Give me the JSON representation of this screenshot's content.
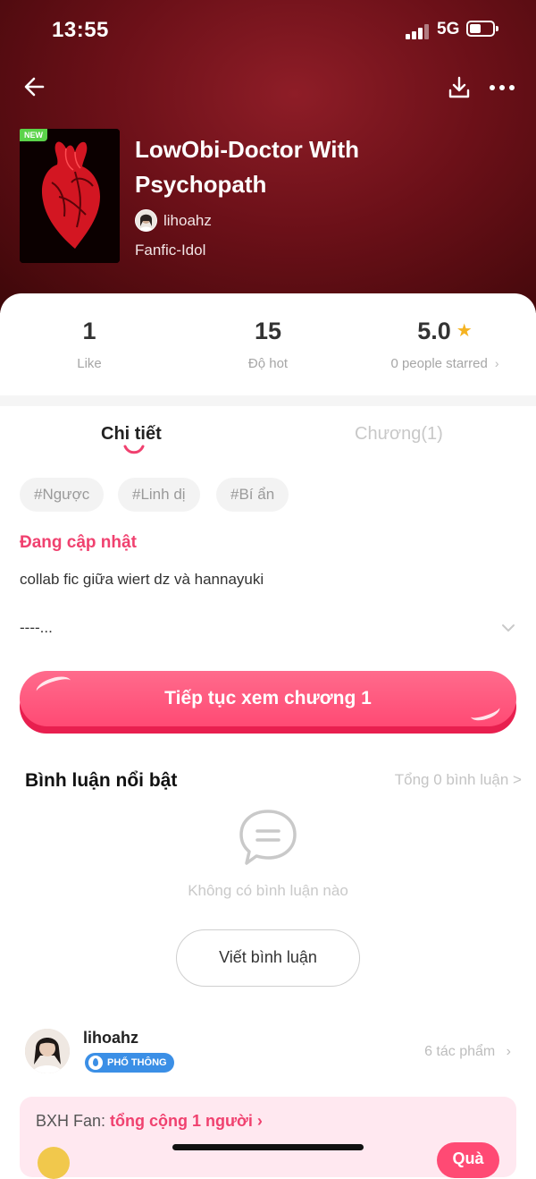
{
  "status_bar": {
    "time": "13:55",
    "network": "5G"
  },
  "header": {
    "back_icon": "arrow-left-icon",
    "download_icon": "download-icon",
    "more_icon": "more-horizontal-icon"
  },
  "book": {
    "badge": "NEW",
    "title": "LowObi-Doctor With Psychopath",
    "author": "lihoahz",
    "category": "Fanfic-Idol"
  },
  "stats": {
    "likes": {
      "value": "1",
      "label": "Like"
    },
    "hot": {
      "value": "15",
      "label": "Độ hot"
    },
    "rating": {
      "value": "5.0",
      "label": "0 people starred"
    }
  },
  "tabs": [
    {
      "label": "Chi tiết",
      "active": true
    },
    {
      "label": "Chương(1)",
      "active": false
    }
  ],
  "tags": [
    "#Ngược",
    "#Linh dị",
    "#Bí ẩn"
  ],
  "details": {
    "status": "Đang cập nhật",
    "description_line1": "collab fic giữa wiert dz và hannayuki",
    "description_line2": "----..."
  },
  "cta": {
    "label": "Tiếp tục xem chương 1"
  },
  "comments": {
    "title": "Bình luận nổi bật",
    "total": "Tổng 0 bình luận >",
    "empty_text": "Không có bình luận nào",
    "write_button": "Viết bình luận"
  },
  "author_card": {
    "name": "lihoahz",
    "rank": "PHỔ THÔNG",
    "works": "6 tác phẩm"
  },
  "fan_ranking": {
    "prefix": "BXH Fan:",
    "highlight": "tổng cộng 1 người",
    "gift_button": "Quà"
  },
  "colors": {
    "accent": "#f0416f",
    "cta": "#ff4a74",
    "hero_bg": "#6b1018",
    "rank_badge": "#3b8fe6"
  }
}
